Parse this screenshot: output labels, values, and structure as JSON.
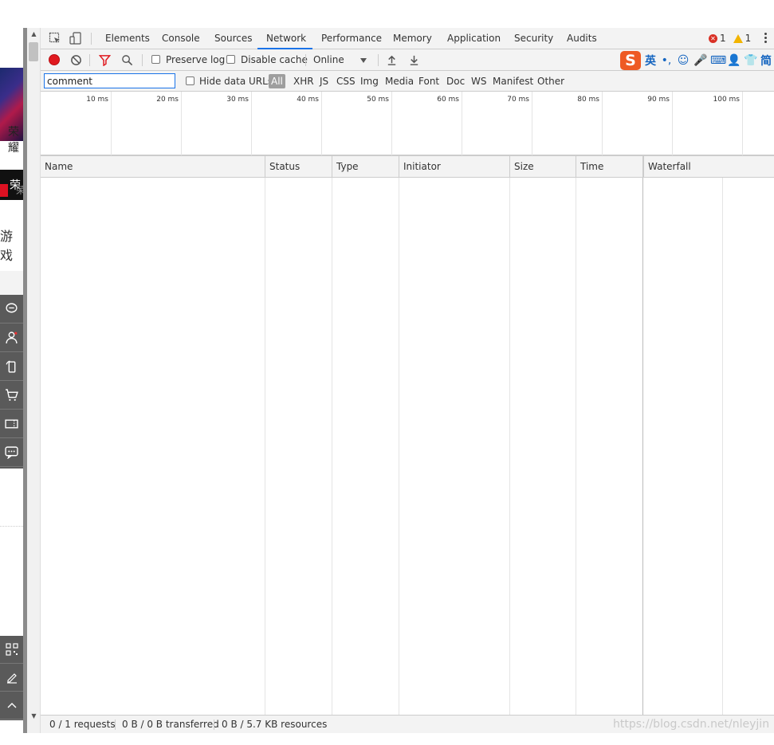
{
  "page": {
    "strip_text_a": "荣耀",
    "strip_text_dark": "荣",
    "strip_text_b": "荣",
    "strip_text_c": "游戏"
  },
  "devtools": {
    "tabs": [
      {
        "label": "Elements",
        "active": false
      },
      {
        "label": "Console",
        "active": false
      },
      {
        "label": "Sources",
        "active": false
      },
      {
        "label": "Network",
        "active": true
      },
      {
        "label": "Performance",
        "active": false
      },
      {
        "label": "Memory",
        "active": false
      },
      {
        "label": "Application",
        "active": false
      },
      {
        "label": "Security",
        "active": false
      },
      {
        "label": "Audits",
        "active": false
      }
    ],
    "error_count": "1",
    "warning_count": "1",
    "toolbar": {
      "preserve_log": "Preserve log",
      "disable_cache": "Disable cache",
      "throttling": "Online"
    },
    "ime": {
      "logo": "S",
      "lang": "英",
      "punct": "•,",
      "smile": "☺",
      "mic": "🎤",
      "keyboard": "⌨",
      "user": "👤",
      "shirt": "👕",
      "simp": "简"
    },
    "filter": {
      "value": "comment",
      "hide_data_urls": "Hide data URLs",
      "types": [
        "All",
        "XHR",
        "JS",
        "CSS",
        "Img",
        "Media",
        "Font",
        "Doc",
        "WS",
        "Manifest",
        "Other"
      ]
    },
    "overview_ticks": [
      "10 ms",
      "20 ms",
      "30 ms",
      "40 ms",
      "50 ms",
      "60 ms",
      "70 ms",
      "80 ms",
      "90 ms",
      "100 ms"
    ],
    "columns": [
      "Name",
      "Status",
      "Type",
      "Initiator",
      "Size",
      "Time",
      "Waterfall"
    ],
    "status": {
      "requests": "0 / 1 requests",
      "transferred": "0 B / 0 B transferred",
      "resources": "0 B / 5.7 KB resources"
    },
    "watermark": "https://blog.csdn.net/nleyjin"
  },
  "colors": {
    "record": "#e0191f",
    "active_tab_underline": "#1a73e8",
    "filter_active": "#e0191f",
    "ime_logo": "#ee5a24",
    "ime_icons": "#1565c0"
  }
}
